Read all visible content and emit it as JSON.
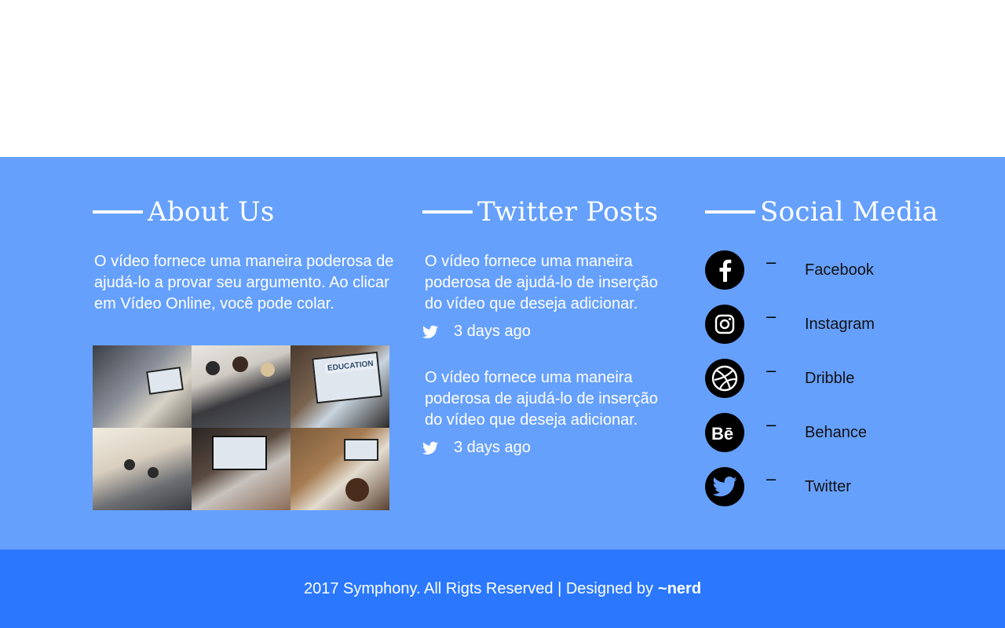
{
  "about": {
    "title": "About Us",
    "text": "O vídeo fornece uma maneira poderosa de ajudá-lo a provar seu argumento. Ao clicar em Vídeo Online, você pode colar.",
    "gallery": [
      {
        "icon": "office-meeting-photo"
      },
      {
        "icon": "business-team-photo"
      },
      {
        "icon": "education-laptop-photo",
        "label": "EDUCATION"
      },
      {
        "icon": "conference-room-photo"
      },
      {
        "icon": "typing-laptop-photo"
      },
      {
        "icon": "desk-workspace-photo"
      }
    ]
  },
  "twitter": {
    "title": "Twitter Posts",
    "posts": [
      {
        "text": "O vídeo fornece uma maneira poderosa de ajudá-lo de inserção do vídeo que deseja adicionar.",
        "time": "3 days ago"
      },
      {
        "text": "O vídeo fornece uma maneira poderosa de ajudá-lo de inserção do vídeo que deseja adicionar.",
        "time": "3 days ago"
      }
    ]
  },
  "social": {
    "title": "Social Media",
    "items": [
      {
        "label": "Facebook",
        "icon": "facebook-icon",
        "dash": "–"
      },
      {
        "label": "Instagram",
        "icon": "instagram-icon",
        "dash": "–"
      },
      {
        "label": "Dribble",
        "icon": "dribbble-icon",
        "dash": "–"
      },
      {
        "label": "Behance",
        "icon": "behance-icon",
        "dash": "–"
      },
      {
        "label": "Twitter",
        "icon": "twitter-icon",
        "dash": "–"
      }
    ]
  },
  "footer": {
    "copyright": "2017 Symphony. All Rigts Reserved | Designed by",
    "brand": "~nerd"
  },
  "colors": {
    "main_bg": "#66a0fd",
    "bottom_bg": "#2b78fe",
    "text": "#ffffff",
    "social_icon_bg": "#000000"
  }
}
